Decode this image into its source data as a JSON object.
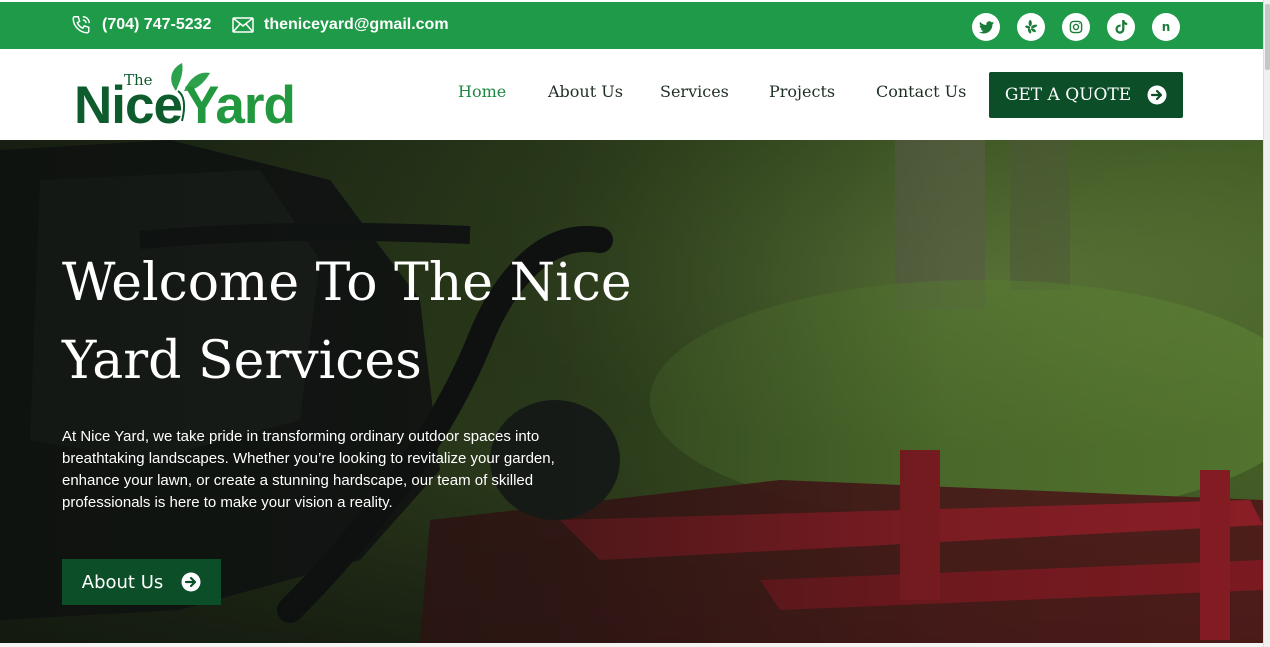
{
  "topbar": {
    "phone": "(704) 747-5232",
    "email": "theniceyard@gmail.com",
    "socials": [
      {
        "icon": "twitter-icon",
        "glyph": "🐦"
      },
      {
        "icon": "yelp-icon",
        "glyph": "✲"
      },
      {
        "icon": "instagram-icon",
        "glyph": "◎"
      },
      {
        "icon": "tiktok-icon",
        "glyph": "♪"
      },
      {
        "icon": "nextdoor-icon",
        "glyph": "n"
      }
    ]
  },
  "logo": {
    "small": "The",
    "nice": "Nice",
    "yard": "Yard"
  },
  "nav": {
    "items": [
      "Home",
      "About Us",
      "Services",
      "Projects",
      "Contact Us"
    ],
    "active": "Home",
    "quote_label": "GET A QUOTE"
  },
  "hero": {
    "title_line1": "Welcome To The Nice",
    "title_line2": "Yard Services",
    "description": "At Nice Yard, we take pride in transforming ordinary outdoor spaces into breathtaking landscapes. Whether you’re looking to revitalize your garden, enhance your lawn, or create a stunning hardscape, our team of skilled professionals is here to make your vision a reality.",
    "button_label": "About Us"
  },
  "colors": {
    "brand_green": "#1e9a48",
    "dark_green": "#0b4e28",
    "nav_active": "#1e8a43"
  }
}
